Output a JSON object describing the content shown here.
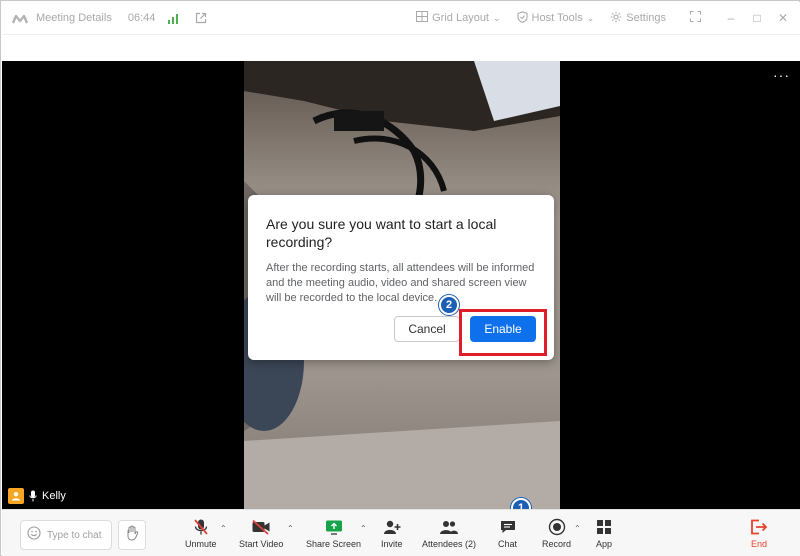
{
  "titlebar": {
    "meeting_details": "Meeting Details",
    "time": "06:44",
    "grid_layout": "Grid Layout",
    "host_tools": "Host Tools",
    "settings": "Settings"
  },
  "video": {
    "participant_name": "Kelly"
  },
  "dialog": {
    "title": "Are you sure you want to start a local recording?",
    "body": "After the recording starts, all attendees will be informed and the meeting audio, video and shared screen view will be recorded to the local device.",
    "cancel_label": "Cancel",
    "enable_label": "Enable"
  },
  "callouts": {
    "step1": "1",
    "step2": "2"
  },
  "toolbar": {
    "chat_placeholder": "Type to chat",
    "unmute": "Unmute",
    "start_video": "Start Video",
    "share_screen": "Share Screen",
    "invite": "Invite",
    "attendees": "Attendees (2)",
    "chat": "Chat",
    "record": "Record",
    "app": "App",
    "end": "End"
  },
  "colors": {
    "accent": "#0e71eb",
    "callout_red": "#e01e2b",
    "badge_blue": "#1a5fb4",
    "end_red": "#e8412c",
    "share_green": "#16a34a",
    "muted_red": "#e0413a"
  }
}
